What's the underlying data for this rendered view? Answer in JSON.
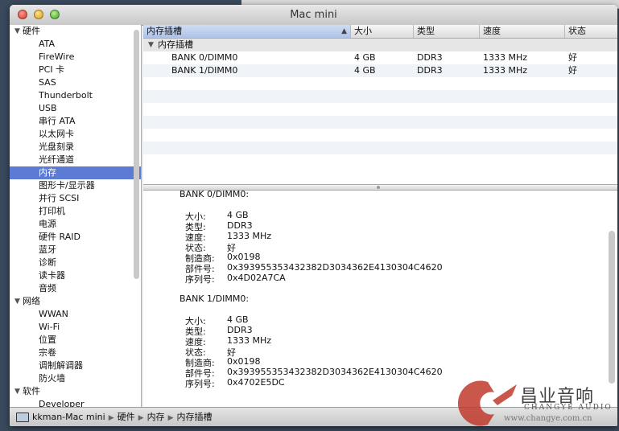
{
  "window": {
    "title": "Mac mini"
  },
  "sidebar": {
    "groups": [
      {
        "label": "硬件",
        "items": [
          "ATA",
          "FireWire",
          "PCI 卡",
          "SAS",
          "Thunderbolt",
          "USB",
          "串行 ATA",
          "以太网卡",
          "光盘刻录",
          "光纤通道",
          "内存",
          "图形卡/显示器",
          "并行 SCSI",
          "打印机",
          "电源",
          "硬件 RAID",
          "蓝牙",
          "诊断",
          "读卡器",
          "音频"
        ]
      },
      {
        "label": "网络",
        "items": [
          "WWAN",
          "Wi-Fi",
          "位置",
          "宗卷",
          "调制解调器",
          "防火墙"
        ]
      },
      {
        "label": "软件",
        "items": [
          "Developer"
        ]
      }
    ],
    "selected": "内存"
  },
  "table": {
    "columns": [
      "内存插槽",
      "大小",
      "类型",
      "速度",
      "状态"
    ],
    "group": "内存插槽",
    "rows": [
      [
        "BANK 0/DIMM0",
        "4 GB",
        "DDR3",
        "1333 MHz",
        "好"
      ],
      [
        "BANK 1/DIMM0",
        "4 GB",
        "DDR3",
        "1333 MHz",
        "好"
      ]
    ]
  },
  "detail": {
    "sections": [
      {
        "title": "BANK 0/DIMM0:",
        "fields": [
          [
            "大小:",
            "4 GB"
          ],
          [
            "类型:",
            "DDR3"
          ],
          [
            "速度:",
            "1333 MHz"
          ],
          [
            "状态:",
            "好"
          ],
          [
            "制造商:",
            "0x0198"
          ],
          [
            "部件号:",
            "0x393955353432382D3034362E4130304C4620"
          ],
          [
            "序列号:",
            "0x4D02A7CA"
          ]
        ]
      },
      {
        "title": "BANK 1/DIMM0:",
        "fields": [
          [
            "大小:",
            "4 GB"
          ],
          [
            "类型:",
            "DDR3"
          ],
          [
            "速度:",
            "1333 MHz"
          ],
          [
            "状态:",
            "好"
          ],
          [
            "制造商:",
            "0x0198"
          ],
          [
            "部件号:",
            "0x393955353432382D3034362E4130304C4620"
          ],
          [
            "序列号:",
            "0x4702E5DC"
          ]
        ]
      }
    ]
  },
  "statusbar": {
    "path": [
      "kkman-Mac mini",
      "硬件",
      "内存",
      "内存插槽"
    ]
  },
  "watermark": {
    "name": "昌业音响",
    "sub": "CHANGYE AUDIO",
    "url": "www.changye.com.cn"
  },
  "colors": {
    "selection": "#5b7bd5",
    "watermark_red": "#c0392b"
  }
}
